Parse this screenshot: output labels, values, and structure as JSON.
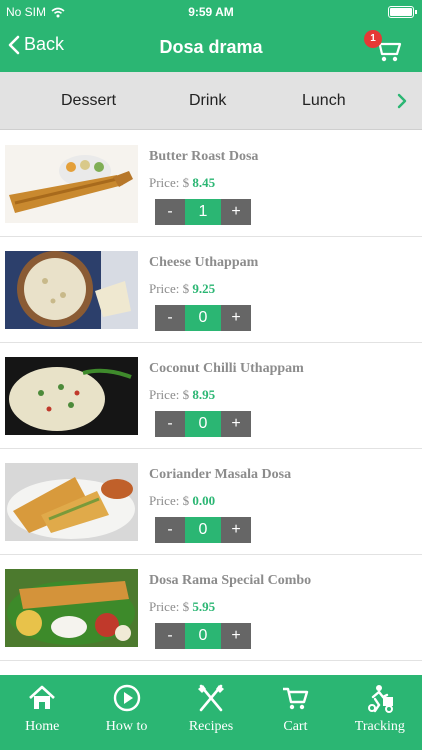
{
  "status_bar": {
    "carrier": "No SIM",
    "time": "9:59 AM"
  },
  "nav": {
    "back_label": "Back",
    "title": "Dosa drama",
    "cart_count": "1"
  },
  "categories": [
    "Dessert",
    "Drink",
    "Lunch"
  ],
  "price_prefix": "Price: $",
  "products": [
    {
      "name": "Butter Roast Dosa",
      "price": "8.45",
      "qty": "1"
    },
    {
      "name": "Cheese Uthappam",
      "price": "9.25",
      "qty": "0"
    },
    {
      "name": "Coconut Chilli Uthappam",
      "price": "8.95",
      "qty": "0"
    },
    {
      "name": "Coriander Masala Dosa",
      "price": "0.00",
      "qty": "0"
    },
    {
      "name": "Dosa Rama Special Combo",
      "price": "5.95",
      "qty": "0"
    }
  ],
  "stepper": {
    "minus": "-",
    "plus": "+"
  },
  "tabs": [
    {
      "label": "Home",
      "icon": "home-icon"
    },
    {
      "label": "How to",
      "icon": "play-icon"
    },
    {
      "label": "Recipes",
      "icon": "fork-knife-icon"
    },
    {
      "label": "Cart",
      "icon": "cart-icon"
    },
    {
      "label": "Tracking",
      "icon": "delivery-icon"
    }
  ],
  "colors": {
    "primary": "#2bb673",
    "stepper_dark": "#666666",
    "badge": "#e53935"
  }
}
